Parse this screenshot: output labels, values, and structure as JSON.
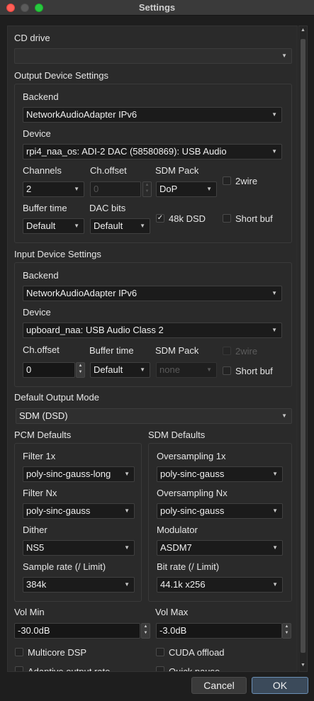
{
  "window": {
    "title": "Settings"
  },
  "cd_drive": {
    "label": "CD drive",
    "value": ""
  },
  "output": {
    "section_title": "Output Device Settings",
    "backend_label": "Backend",
    "backend_value": "NetworkAudioAdapter IPv6",
    "device_label": "Device",
    "device_value": "rpi4_naa_os: ADI-2 DAC (58580869): USB Audio",
    "channels_label": "Channels",
    "channels_value": "2",
    "choffset_label": "Ch.offset",
    "choffset_value": "0",
    "sdmpack_label": "SDM Pack",
    "sdmpack_value": "DoP",
    "twowire_label": "2wire",
    "twowire_checked": false,
    "buffertime_label": "Buffer time",
    "buffertime_value": "Default",
    "dacbits_label": "DAC bits",
    "dacbits_value": "Default",
    "dsd48k_label": "48k DSD",
    "dsd48k_checked": true,
    "shortbuf_label": "Short buf",
    "shortbuf_checked": false
  },
  "input": {
    "section_title": "Input Device Settings",
    "backend_label": "Backend",
    "backend_value": "NetworkAudioAdapter IPv6",
    "device_label": "Device",
    "device_value": "upboard_naa: USB Audio Class 2",
    "choffset_label": "Ch.offset",
    "choffset_value": "0",
    "buffertime_label": "Buffer time",
    "buffertime_value": "Default",
    "sdmpack_label": "SDM Pack",
    "sdmpack_value": "none",
    "twowire_label": "2wire",
    "twowire_checked": false,
    "shortbuf_label": "Short buf",
    "shortbuf_checked": false
  },
  "default_output_mode": {
    "label": "Default Output Mode",
    "value": "SDM (DSD)"
  },
  "pcm_defaults": {
    "title": "PCM Defaults",
    "filter1x_label": "Filter 1x",
    "filter1x_value": "poly-sinc-gauss-long",
    "filternx_label": "Filter Nx",
    "filternx_value": "poly-sinc-gauss",
    "dither_label": "Dither",
    "dither_value": "NS5",
    "samplerate_label": "Sample rate (/ Limit)",
    "samplerate_value": "384k"
  },
  "sdm_defaults": {
    "title": "SDM Defaults",
    "os1x_label": "Oversampling 1x",
    "os1x_value": "poly-sinc-gauss",
    "osnx_label": "Oversampling Nx",
    "osnx_value": "poly-sinc-gauss",
    "modulator_label": "Modulator",
    "modulator_value": "ASDM7",
    "bitrate_label": "Bit rate (/ Limit)",
    "bitrate_value": "44.1k x256"
  },
  "volume": {
    "min_label": "Vol Min",
    "min_value": "-30.0dB",
    "max_label": "Vol Max",
    "max_value": "-3.0dB"
  },
  "options": {
    "multicore_label": "Multicore DSP",
    "multicore_checked": false,
    "cuda_label": "CUDA offload",
    "cuda_checked": false,
    "adaptive_label": "Adaptive output rate",
    "adaptive_checked": false,
    "quickpause_label": "Quick pause",
    "quickpause_checked": false
  },
  "buttons": {
    "cancel": "Cancel",
    "ok": "OK"
  },
  "icons": {
    "dropdown": "chevron-down-icon",
    "spin": "spin-arrows-icon",
    "check": "checkmark-icon"
  },
  "colors": {
    "ok_border": "#6b8fb5",
    "close": "#ff5f57",
    "zoom": "#28c840"
  }
}
